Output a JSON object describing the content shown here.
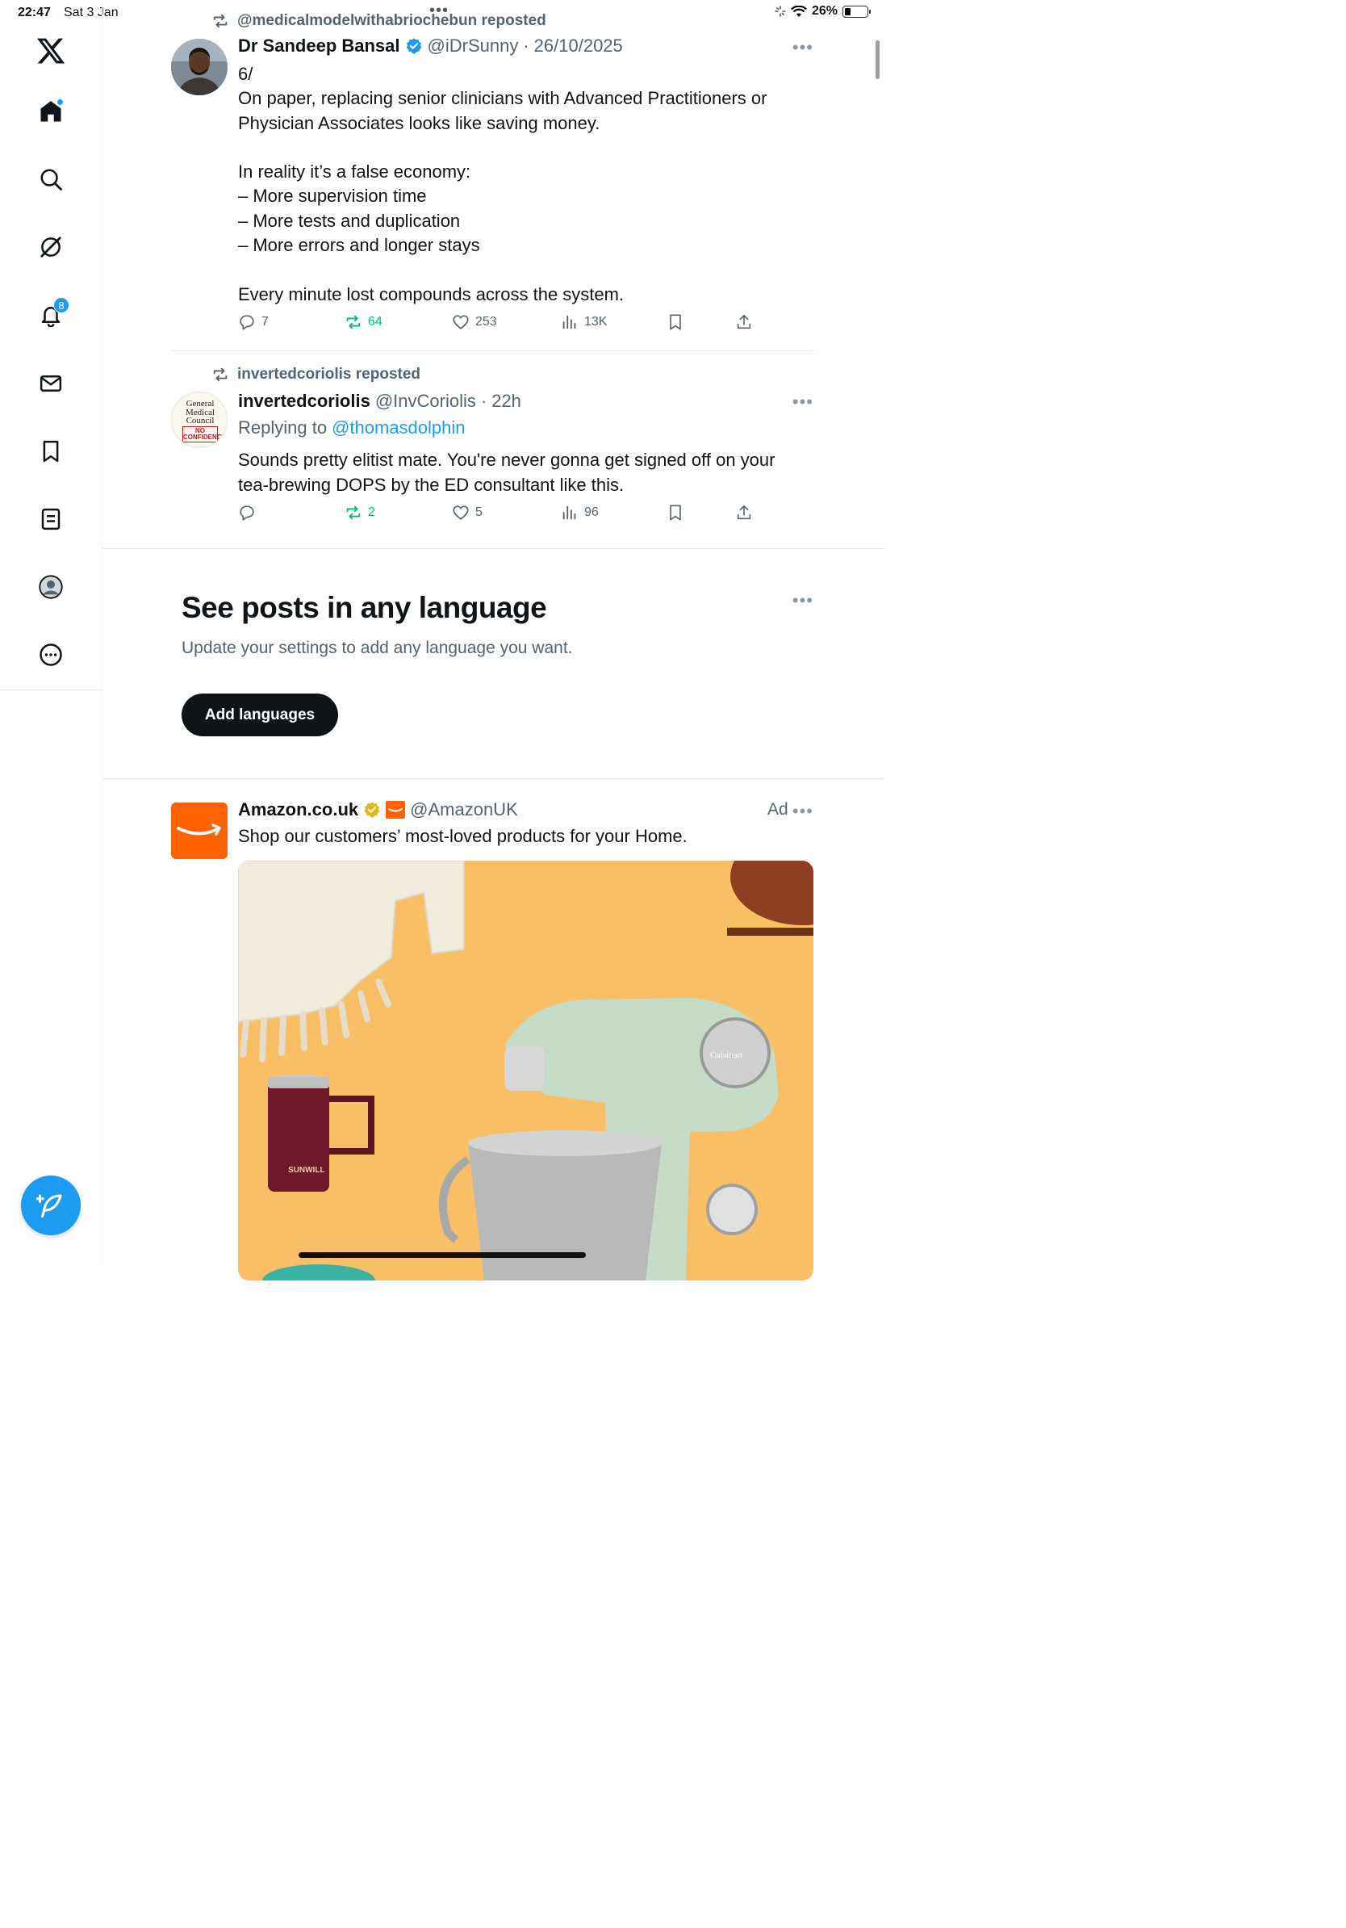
{
  "status_bar": {
    "time": "22:47",
    "date": "Sat 3 Jan",
    "battery": "26%",
    "battery_level": 0.26
  },
  "sidebar": {
    "items": [
      "x-logo",
      "home",
      "search",
      "grok",
      "notifications",
      "messages",
      "bookmarks",
      "lists",
      "profile",
      "more"
    ],
    "notifications_badge": "8"
  },
  "tweets": [
    {
      "repost_by": "@medicalmodelwithabriochebun reposted",
      "name": "Dr Sandeep Bansal",
      "handle": "@iDrSunny",
      "sep": "·",
      "time": "26/10/2025",
      "text": "6/\nOn paper, replacing senior clinicians with Advanced Practitioners or\nPhysician Associates looks like saving money.\n\nIn reality it’s a false economy:\n– More supervision time\n– More tests and duplication\n– More errors and longer stays\n\nEvery minute lost compounds across the system.",
      "replies": "7",
      "reposts": "64",
      "likes": "253",
      "views": "13K"
    },
    {
      "repost_by": "invertedcoriolis reposted",
      "name": "invertedcoriolis",
      "handle": "@InvCoriolis",
      "sep": "·",
      "time": "22h",
      "replying_label": "Replying to",
      "replying_to": "@thomasdolphin",
      "text": "Sounds pretty elitist mate. You're never gonna get signed off on your\ntea-brewing DOPS by the ED consultant like this.",
      "avatar_text": [
        "General",
        "Medical",
        "Council",
        "NO",
        "CONFIDENCE"
      ],
      "replies": "",
      "reposts": "2",
      "likes": "5",
      "views": "96"
    }
  ],
  "language_prompt": {
    "title": "See posts in any language",
    "subtitle": "Update your settings to add any language you want.",
    "button": "Add languages"
  },
  "ad": {
    "name": "Amazon.co.uk",
    "handle": "@AmazonUK",
    "label": "Ad",
    "text": "Shop our customers’ most-loved products for your Home.",
    "mixer_brand": "Cuisinart",
    "mug_brand": "SUNWILL"
  },
  "colors": {
    "accent": "#1d9bf0",
    "repost_green": "#00ba7c",
    "amazon_orange": "#ff6200",
    "verified_gold": "#e2b719",
    "ad_background": "#f9bf66",
    "mixer_green": "#c7dcc7",
    "mug_burgundy": "#6e1a2b"
  }
}
